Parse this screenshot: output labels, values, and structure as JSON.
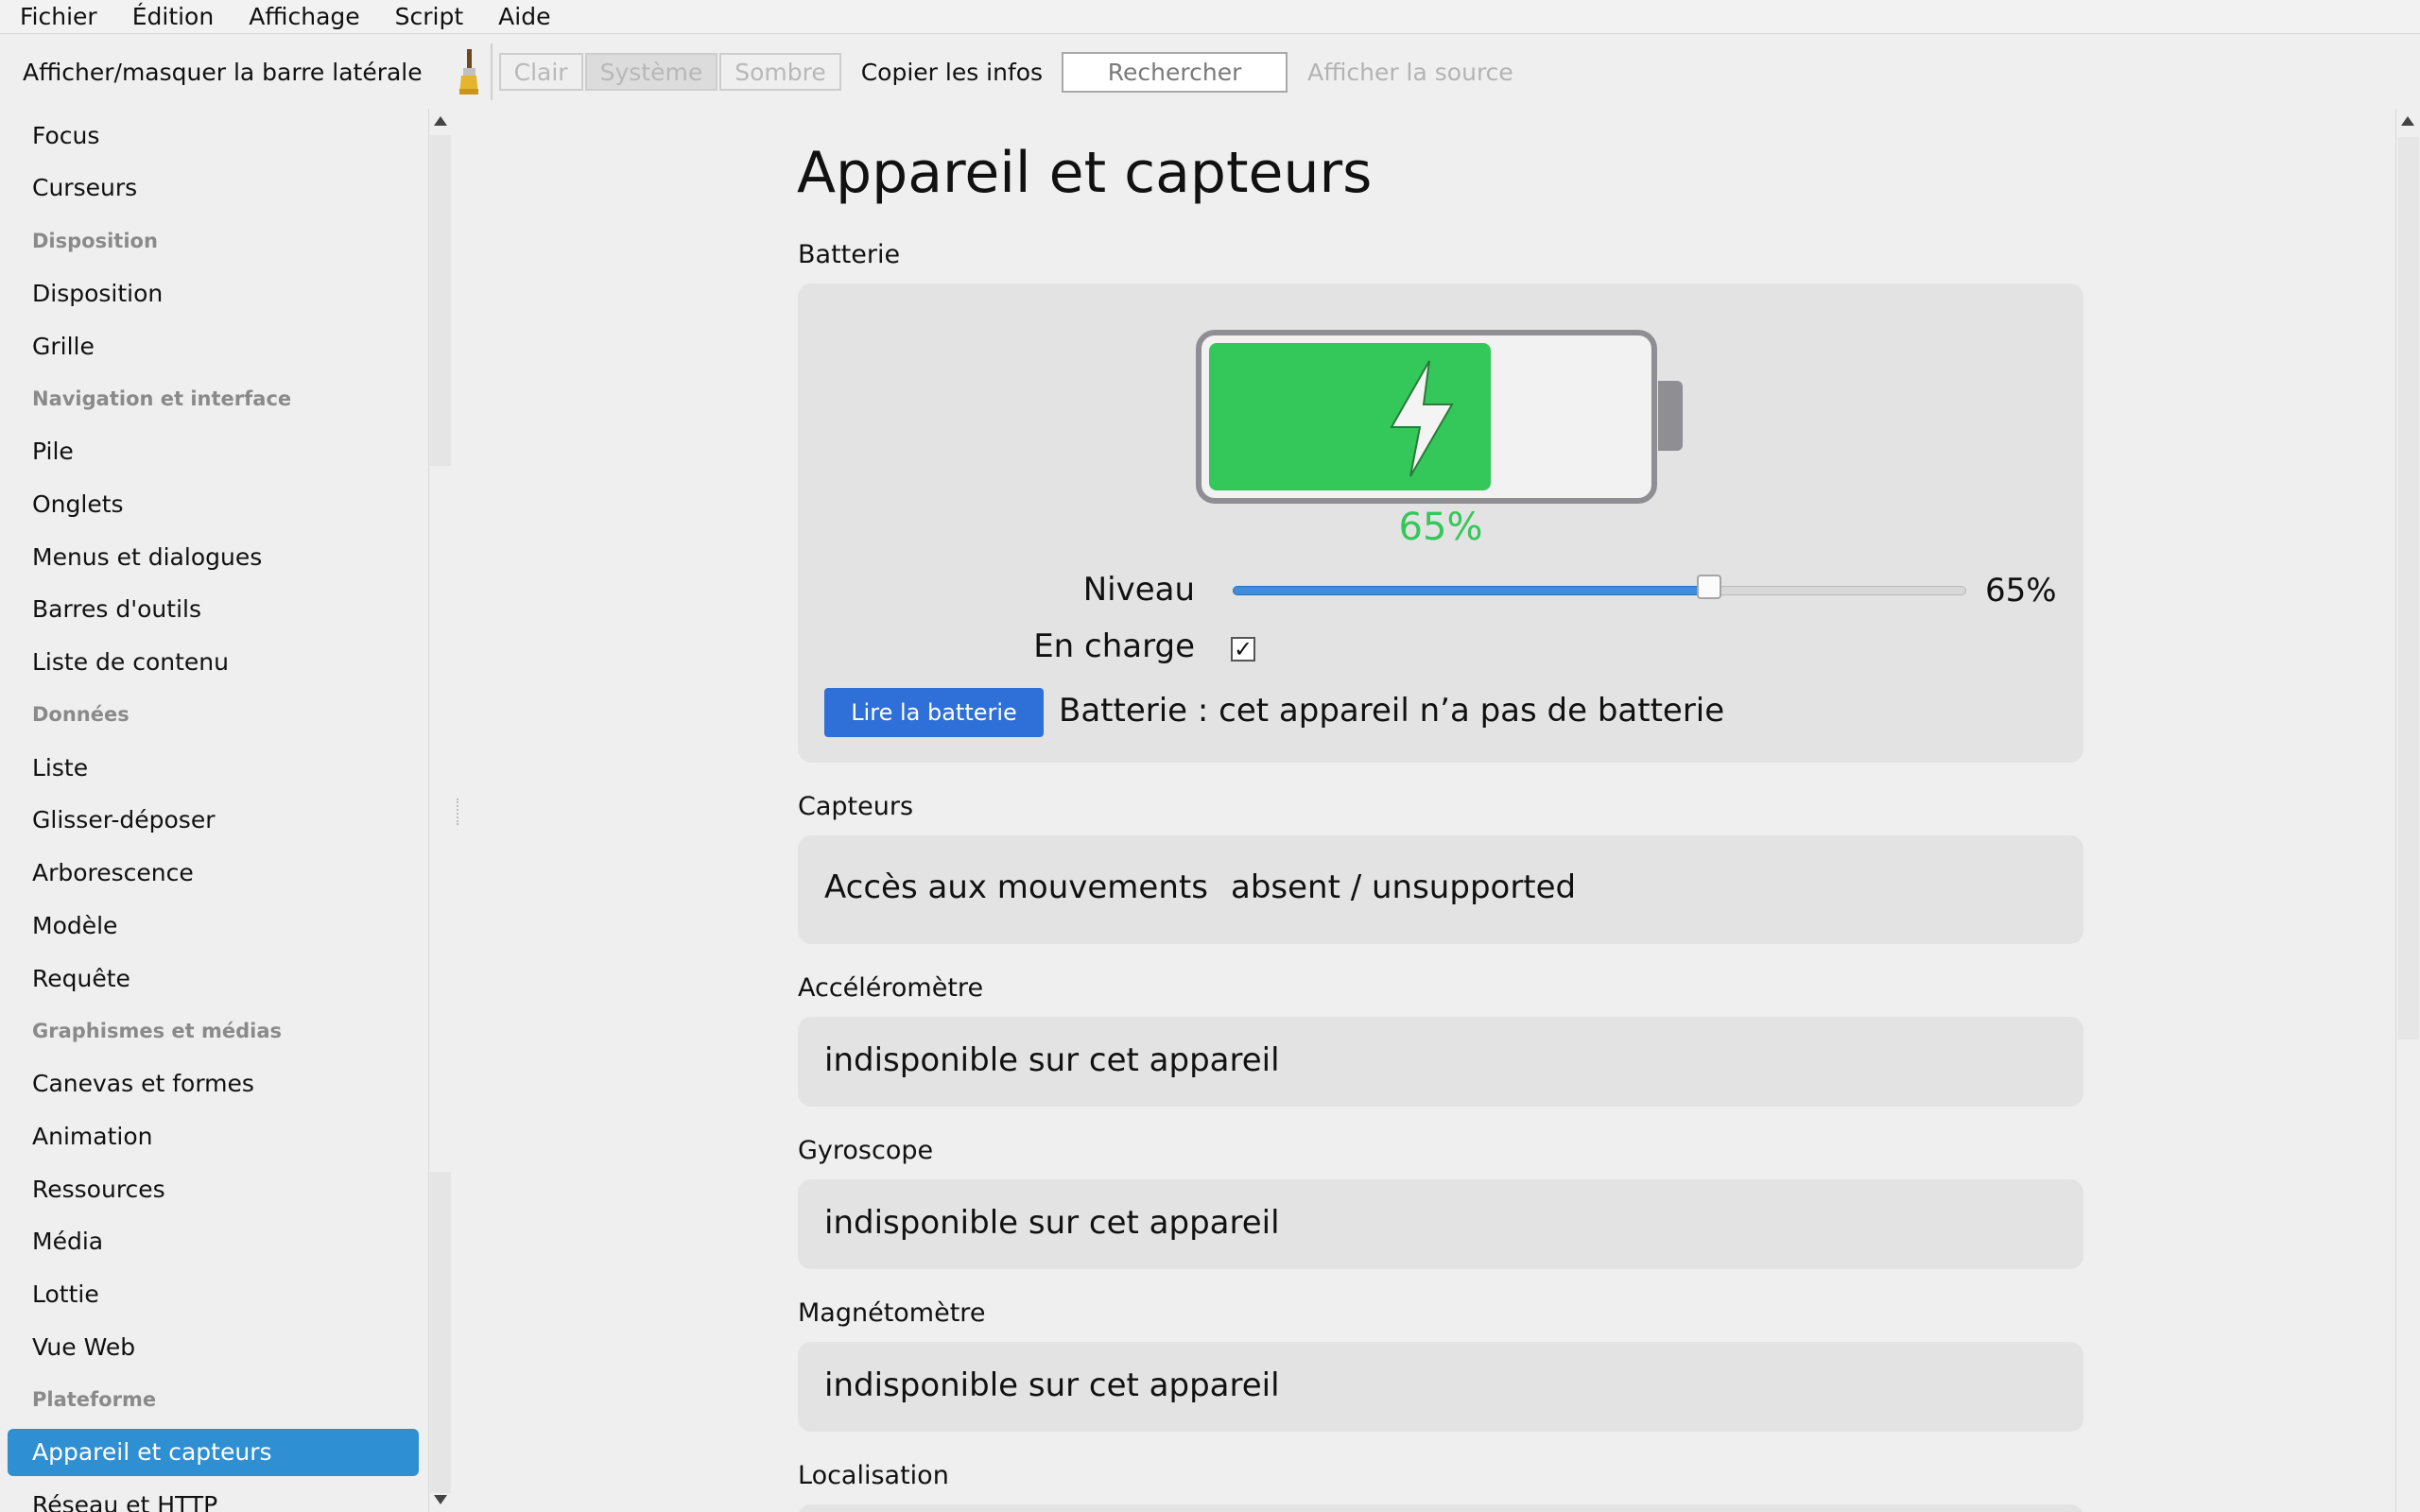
{
  "menu": [
    "Fichier",
    "Édition",
    "Affichage",
    "Script",
    "Aide"
  ],
  "toolbar": {
    "toggle_sidebar": "Afficher/masquer la barre latérale",
    "themes": [
      "Clair",
      "Système",
      "Sombre"
    ],
    "active_theme": "Système",
    "copy_info": "Copier les infos",
    "search_placeholder": "Rechercher",
    "view_source": "Afficher la source"
  },
  "sidebar": {
    "items": [
      {
        "label": "Focus",
        "type": "item"
      },
      {
        "label": "Curseurs",
        "type": "item"
      },
      {
        "label": "Disposition",
        "type": "header"
      },
      {
        "label": "Disposition",
        "type": "item"
      },
      {
        "label": "Grille",
        "type": "item"
      },
      {
        "label": "Navigation et interface",
        "type": "header"
      },
      {
        "label": "Pile",
        "type": "item"
      },
      {
        "label": "Onglets",
        "type": "item"
      },
      {
        "label": "Menus et dialogues",
        "type": "item"
      },
      {
        "label": "Barres d'outils",
        "type": "item"
      },
      {
        "label": "Liste de contenu",
        "type": "item"
      },
      {
        "label": "Données",
        "type": "header"
      },
      {
        "label": "Liste",
        "type": "item"
      },
      {
        "label": "Glisser-déposer",
        "type": "item"
      },
      {
        "label": "Arborescence",
        "type": "item"
      },
      {
        "label": "Modèle",
        "type": "item"
      },
      {
        "label": "Requête",
        "type": "item"
      },
      {
        "label": "Graphismes et médias",
        "type": "header"
      },
      {
        "label": "Canevas et formes",
        "type": "item"
      },
      {
        "label": "Animation",
        "type": "item"
      },
      {
        "label": "Ressources",
        "type": "item"
      },
      {
        "label": "Média",
        "type": "item"
      },
      {
        "label": "Lottie",
        "type": "item"
      },
      {
        "label": "Vue Web",
        "type": "item"
      },
      {
        "label": "Plateforme",
        "type": "header"
      },
      {
        "label": "Appareil et capteurs",
        "type": "item",
        "selected": true
      },
      {
        "label": "Réseau et HTTP",
        "type": "item"
      }
    ]
  },
  "main": {
    "title": "Appareil et capteurs",
    "battery": {
      "section_label": "Batterie",
      "level_fraction": 0.65,
      "level_text": "65%",
      "level_label": "Niveau",
      "slider_value_text": "65%",
      "charging_label": "En charge",
      "charging": true,
      "read_button": "Lire la batterie",
      "status": "Batterie : cet appareil n’a pas de batterie",
      "fill_color": "#34c759"
    },
    "sensors": {
      "section_label": "Capteurs",
      "motion_label": "Accès aux mouvements",
      "motion_value": "absent / unsupported"
    },
    "accelerometer": {
      "section_label": "Accéléromètre",
      "value": "indisponible sur cet appareil"
    },
    "gyroscope": {
      "section_label": "Gyroscope",
      "value": "indisponible sur cet appareil"
    },
    "magnetometer": {
      "section_label": "Magnétomètre",
      "value": "indisponible sur cet appareil"
    },
    "location": {
      "section_label": "Localisation"
    }
  },
  "colors": {
    "accent": "#2f8fd3",
    "button": "#2e6fd8",
    "battery": "#34c759"
  }
}
